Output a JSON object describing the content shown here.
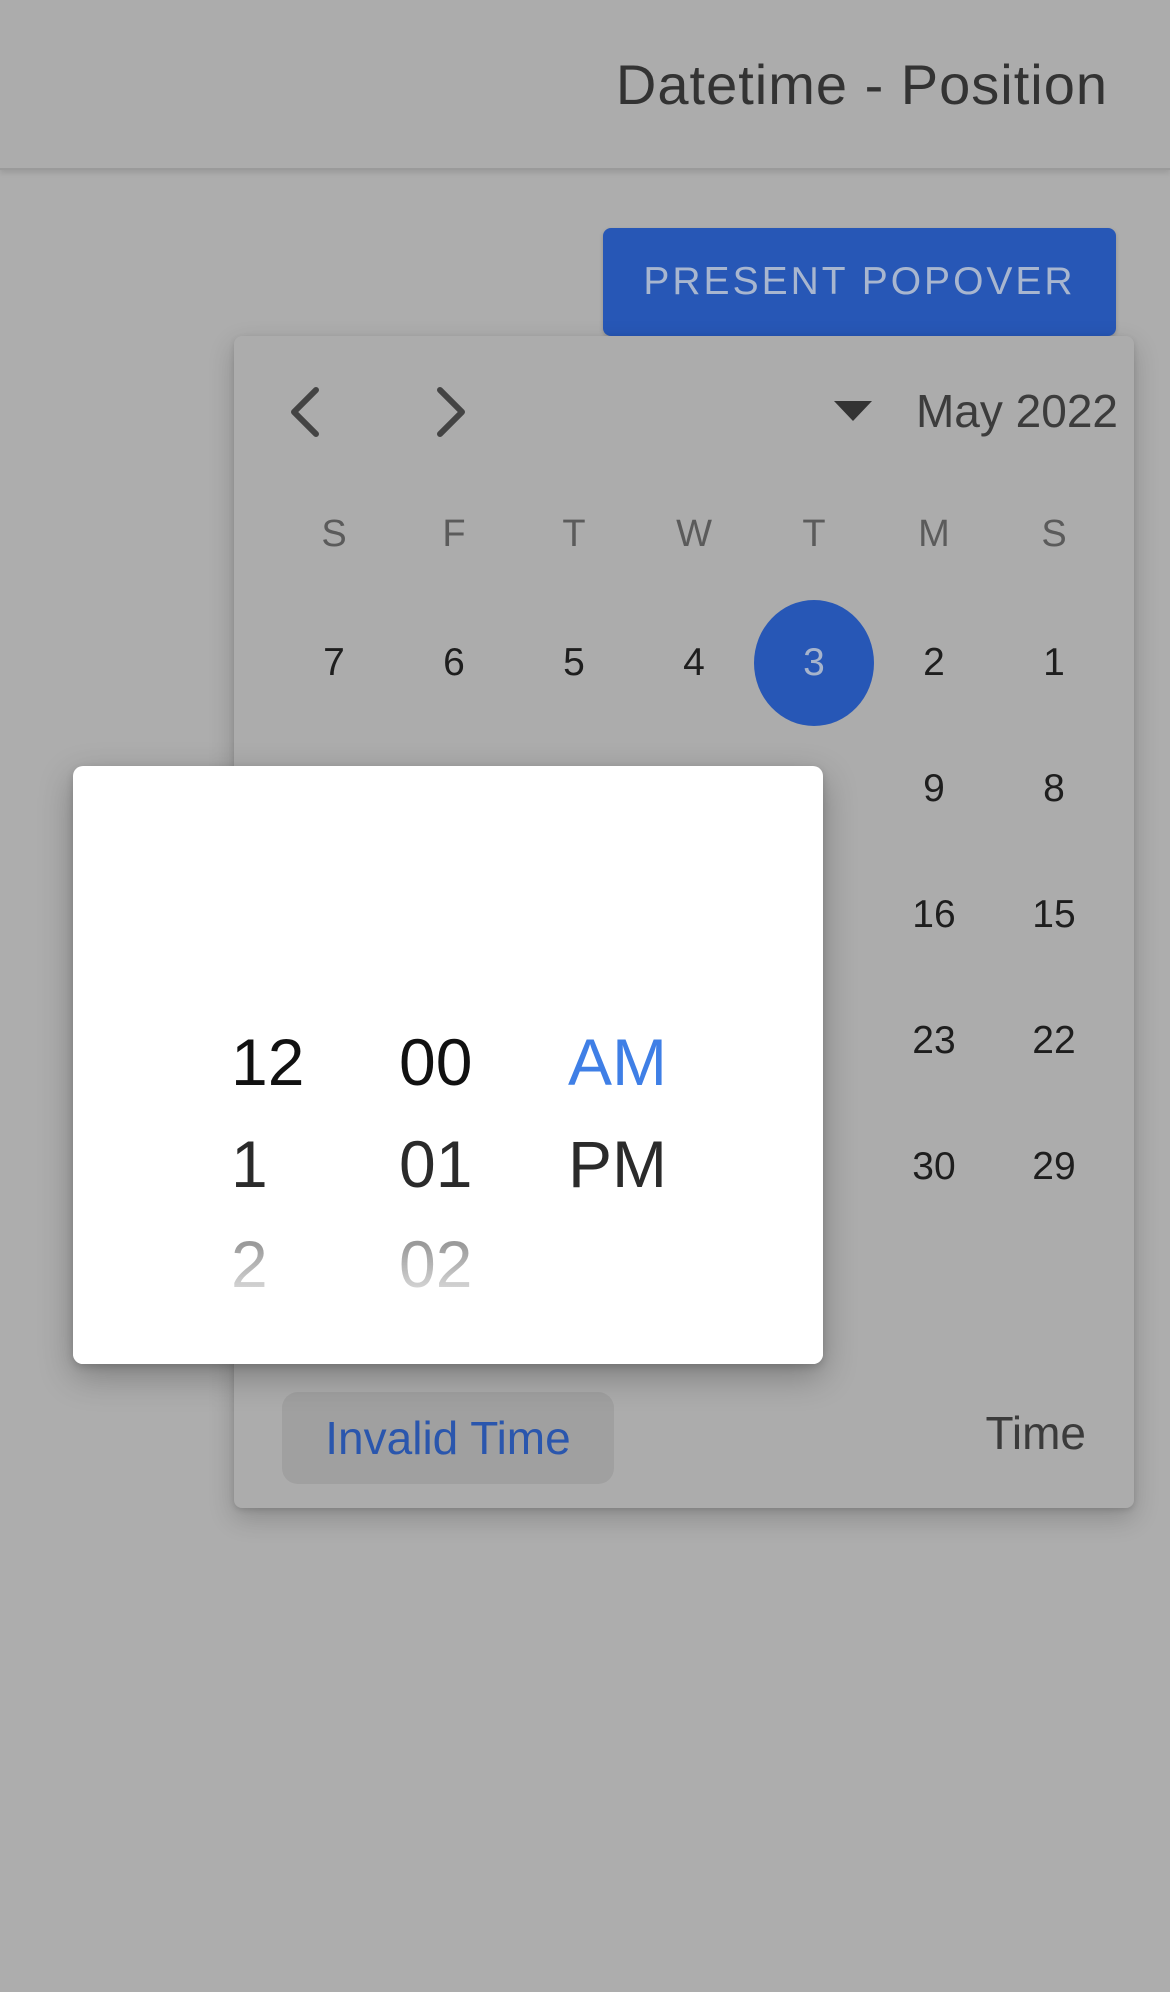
{
  "header": {
    "title": "Datetime - Position"
  },
  "toolbar": {
    "present_label": "PRESENT POPOVER"
  },
  "calendar": {
    "month_year": "May 2022",
    "weekdays": [
      "S",
      "F",
      "T",
      "W",
      "T",
      "M",
      "S"
    ],
    "weeks": [
      [
        "7",
        "6",
        "5",
        "4",
        "3",
        "2",
        "1"
      ],
      [
        "",
        "",
        "",
        "",
        "",
        "9",
        "8"
      ],
      [
        "",
        "",
        "",
        "",
        "",
        "16",
        "15"
      ],
      [
        "",
        "",
        "",
        "",
        "",
        "23",
        "22"
      ],
      [
        "",
        "",
        "",
        "",
        "",
        "30",
        "29"
      ]
    ],
    "selected_day": "3",
    "invalid_time_label": "Invalid Time",
    "time_label": "Time"
  },
  "time_picker": {
    "hours": [
      "12",
      "1",
      "2"
    ],
    "minutes": [
      "00",
      "01",
      "02"
    ],
    "periods": [
      "AM",
      "PM"
    ],
    "active_period": "AM"
  },
  "colors": {
    "accent": "#2757b6",
    "active_picker": "#3f7fe6",
    "backdrop": "#adadad"
  },
  "icons": {
    "prev": "chevron-left-icon",
    "next": "chevron-right-icon",
    "dropdown": "caret-down-icon"
  }
}
